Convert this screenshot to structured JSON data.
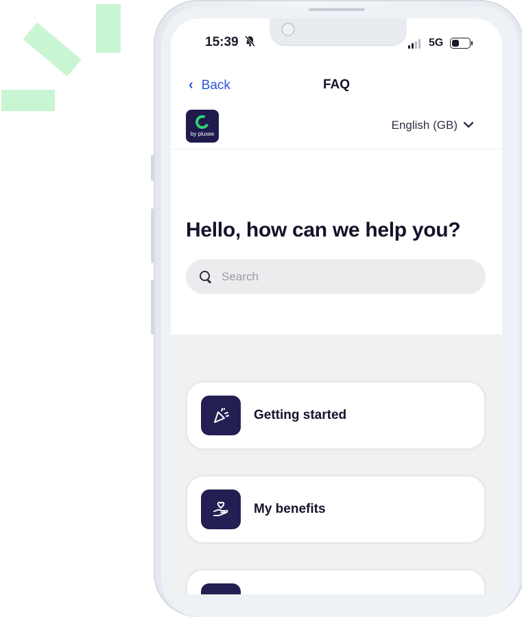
{
  "status_bar": {
    "time": "15:39",
    "network": "5G"
  },
  "nav": {
    "back_label": "Back",
    "title": "FAQ"
  },
  "logo": {
    "brand_text": "by pluxee"
  },
  "language": {
    "selected": "English (GB)"
  },
  "heading": "Hello, how can we help you?",
  "search": {
    "placeholder": "Search"
  },
  "categories": [
    {
      "label": "Getting started",
      "icon": "party-popper-icon"
    },
    {
      "label": "My benefits",
      "icon": "hand-heart-icon"
    }
  ],
  "colors": {
    "accent": "#2b55d6",
    "brand_navy": "#241f52",
    "brand_green": "#2fd36b",
    "decor_green": "#c8f5d2"
  }
}
